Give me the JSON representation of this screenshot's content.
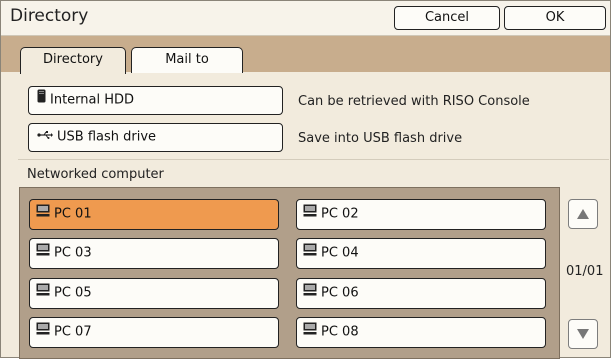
{
  "window": {
    "title": "Directory"
  },
  "buttons": {
    "cancel": "Cancel",
    "ok": "OK"
  },
  "tabs": [
    {
      "label": "Directory",
      "active": true
    },
    {
      "label": "Mail to",
      "active": false
    }
  ],
  "storage": [
    {
      "label": "Internal HDD",
      "description": "Can be retrieved with RISO Console",
      "icon": "hard-drive-icon"
    },
    {
      "label": "USB flash drive",
      "description": "Save into USB flash drive",
      "icon": "usb-icon"
    }
  ],
  "network": {
    "label": "Networked computer",
    "computers": [
      "PC 01",
      "PC 02",
      "PC 03",
      "PC 04",
      "PC 05",
      "PC 06",
      "PC 07",
      "PC 08"
    ],
    "selected": "PC 01"
  },
  "pager": {
    "indicator": "01/01"
  },
  "colors": {
    "selected": "#ef9a4f",
    "tab_bar": "#c8ad8d",
    "panel": "#f2ebdd"
  }
}
